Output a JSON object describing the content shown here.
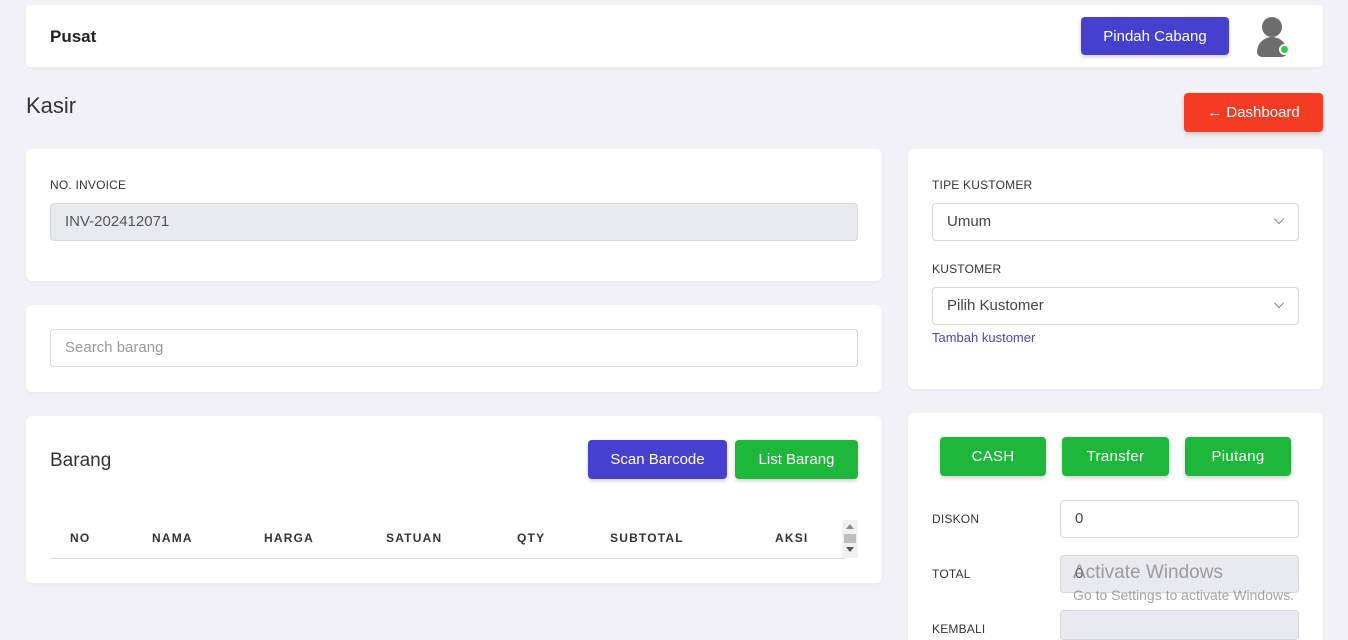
{
  "header": {
    "brand": "Pusat",
    "switch_branch_label": "Pindah Cabang"
  },
  "page": {
    "title": "Kasir",
    "dashboard_label": "← Dashboard"
  },
  "invoice": {
    "label": "NO. INVOICE",
    "value": "INV-202412071"
  },
  "search": {
    "placeholder": "Search barang"
  },
  "items": {
    "title": "Barang",
    "scan_label": "Scan Barcode",
    "list_label": "List Barang",
    "columns": [
      "NO",
      "NAMA",
      "HARGA",
      "SATUAN",
      "QTY",
      "SUBTOTAL",
      "AKSI"
    ]
  },
  "customer": {
    "type_label": "TIPE KUSTOMER",
    "type_value": "Umum",
    "customer_label": "KUSTOMER",
    "customer_value": "Pilih Kustomer",
    "add_link": "Tambah kustomer"
  },
  "payment": {
    "methods": [
      "CASH",
      "Transfer",
      "Piutang"
    ],
    "discount_label": "DISKON",
    "discount_value": "0",
    "total_label": "TOTAL",
    "total_value": "0",
    "change_label": "KEMBALI",
    "change_value": ""
  },
  "watermark": {
    "title": "Activate Windows",
    "subtitle": "Go to Settings to activate Windows."
  },
  "colors": {
    "primary": "#4640cf",
    "danger": "#f43c22",
    "success": "#1db73c",
    "background": "#f2f1f8"
  }
}
